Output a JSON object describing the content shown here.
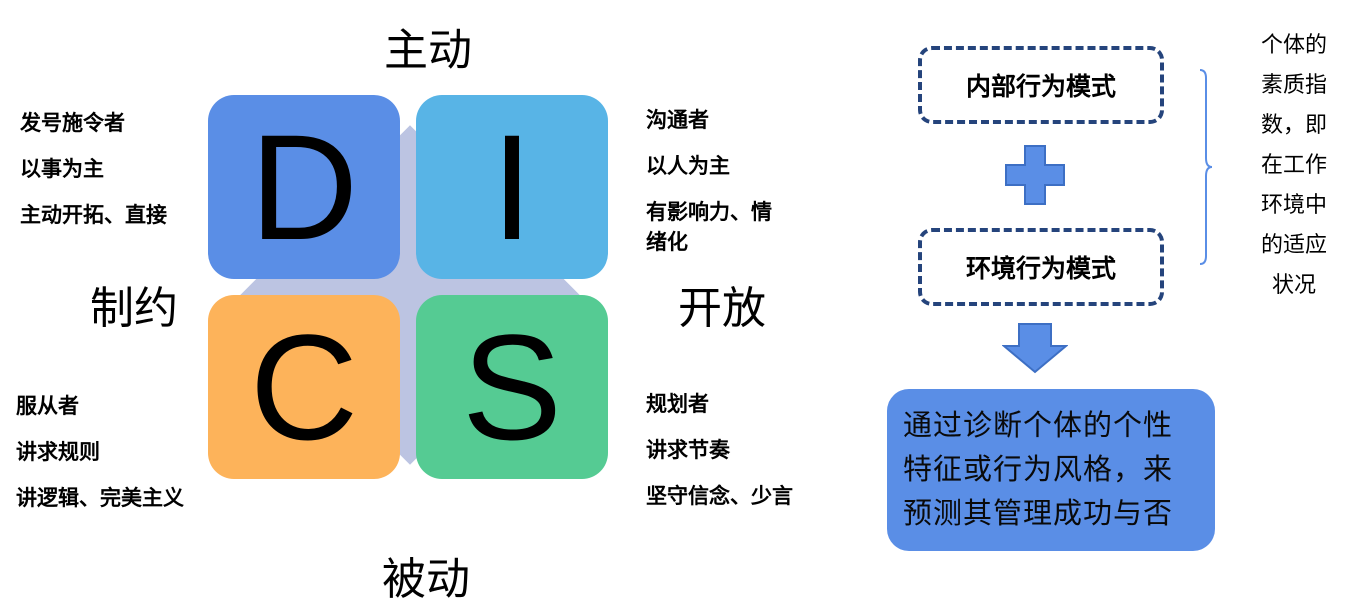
{
  "axes": {
    "top": "主动",
    "bottom": "被动",
    "left": "制约",
    "right": "开放"
  },
  "quadrants": {
    "d": "D",
    "i": "I",
    "c": "C",
    "s": "S"
  },
  "d_traits": [
    "发号施令者",
    "以事为主",
    "主动开拓、直接"
  ],
  "i_traits": [
    "沟通者",
    "以人为主",
    "有影响力、情",
    "绪化"
  ],
  "c_traits": [
    "服从者",
    "讲求规则",
    "讲逻辑、完美主义"
  ],
  "s_traits": [
    "规划者",
    "讲求节奏",
    "坚守信念、少言"
  ],
  "flow": {
    "box1": "内部行为模式",
    "box2": "环境行为模式",
    "result": "通过诊断个体的个性特征或行为风格，来预测其管理成功与否"
  },
  "side_note": [
    "个体的",
    "素质指",
    "数，即",
    "在工作",
    "环境中",
    "的适应",
    "状况"
  ],
  "colors": {
    "d": "#5a8ee6",
    "i": "#58b4e6",
    "c": "#fdb35a",
    "s": "#55cb93",
    "diamond": "#bcc4e2",
    "arrow": "#5a8ee6",
    "dash": "#25447c"
  }
}
